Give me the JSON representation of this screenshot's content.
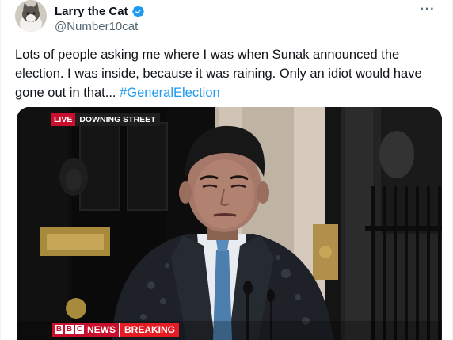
{
  "author": {
    "display_name": "Larry the Cat",
    "handle": "@Number10cat",
    "verified_color": "#1d9bf0"
  },
  "menu": {
    "more_icon": "ellipsis-icon",
    "more_label": "···"
  },
  "tweet": {
    "text_main": "Lots of people asking me where I was when Sunak announced the election. I was inside, because it was raining. Only an idiot would have gone out in that... ",
    "hashtag": "#GeneralElection"
  },
  "media": {
    "live_label": "LIVE",
    "location_label": "DOWNING STREET",
    "bbc_letters": [
      "B",
      "B",
      "C"
    ],
    "news_label": "NEWS",
    "breaking_label": "BREAKING"
  },
  "colors": {
    "text": "#0f1419",
    "secondary": "#536471",
    "link": "#1d9bf0",
    "bbc_red": "#c8102e"
  }
}
